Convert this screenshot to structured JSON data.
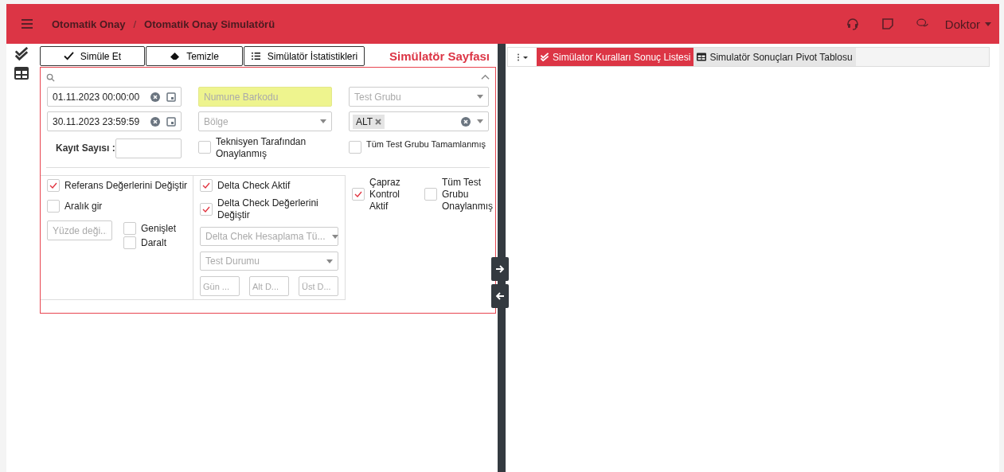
{
  "header": {
    "breadcrumb": [
      "Otomatik Onay",
      "Otomatik Onay Simulatörü"
    ],
    "separator": "/",
    "user": "Doktor"
  },
  "toolbar": {
    "buttons": [
      {
        "label": "Simüle Et"
      },
      {
        "label": "Temizle"
      },
      {
        "label": "Simülatör İstatistikleri"
      }
    ],
    "title": "Simülatör Sayfası"
  },
  "filters": {
    "start_date": "01.11.2023 00:00:00",
    "end_date": "30.11.2023 23:59:59",
    "barcode_placeholder": "Numune Barkodu",
    "region_placeholder": "Bölge",
    "test_group_placeholder": "Test Grubu",
    "tags": [
      "ALT"
    ],
    "record_count_label": "Kayıt Sayısı :",
    "technician_approved": {
      "label": "Teknisyen Tarafından Onaylanmış",
      "checked": false
    },
    "all_groups_completed": {
      "label": "Tüm Test Grubu Tamamlanmış",
      "checked": false
    }
  },
  "reference": {
    "change": {
      "label": "Referans Değerlerini Değiştir",
      "checked": true
    },
    "range": {
      "label": "Aralık gir",
      "checked": false
    },
    "percent_placeholder": "Yüzde deği...",
    "expand": {
      "label": "Genişlet",
      "checked": false
    },
    "narrow": {
      "label": "Daralt",
      "checked": false
    }
  },
  "delta": {
    "active": {
      "label": "Delta Check Aktif",
      "checked": true
    },
    "change": {
      "label": "Delta Check Değerlerini Değiştir",
      "checked": true
    },
    "calc_placeholder": "Delta Chek Hesaplama Tü...",
    "status_placeholder": "Test Durumu",
    "input_placeholders": [
      "Gün ...",
      "Alt D...",
      "Üst D..."
    ]
  },
  "cross": {
    "label": "Çapraz Kontrol Aktif",
    "checked": true
  },
  "all_approved": {
    "label": "Tüm Test Grubu Onaylanmış",
    "checked": false
  },
  "tabs": [
    {
      "label": "Simülator Kuralları Sonuç Listesi",
      "selected": true
    },
    {
      "label": "Simulatör Sonuçları Pivot Tablosu",
      "selected": false
    }
  ]
}
